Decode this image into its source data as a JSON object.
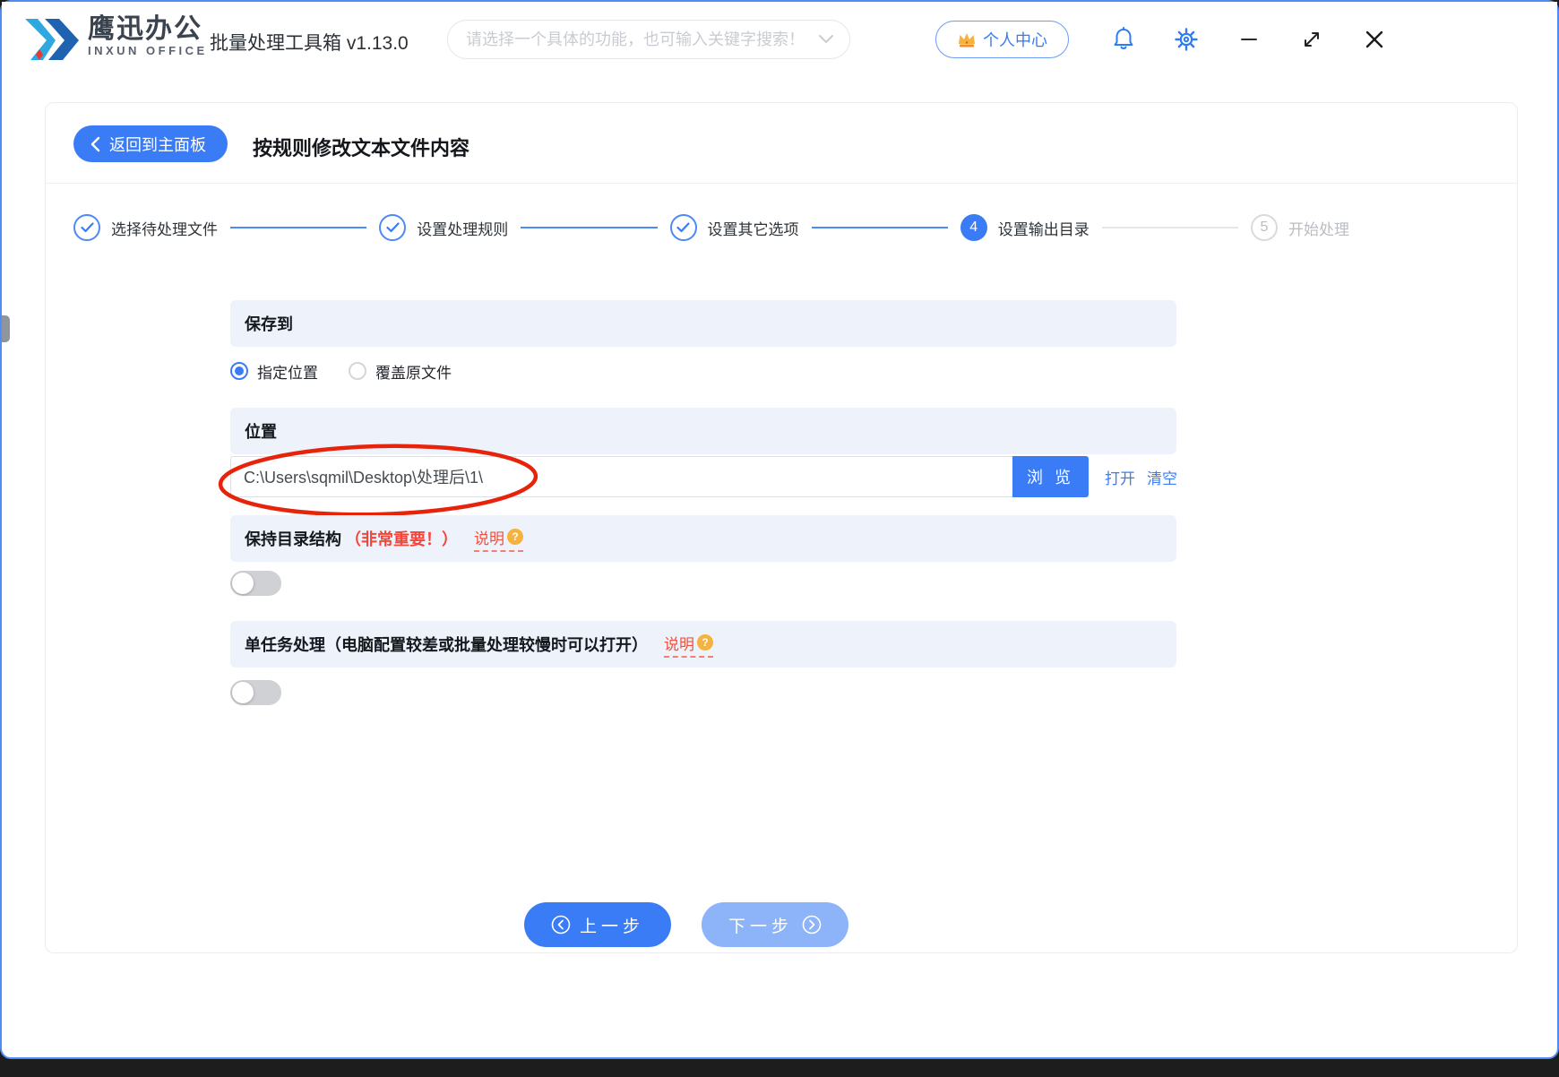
{
  "window": {
    "brand": {
      "name_cn": "鹰迅办公",
      "name_en": "INXUN OFFICE"
    },
    "app_title": "批量处理工具箱 v1.13.0",
    "search_placeholder": "请选择一个具体的功能，也可输入关键字搜索！",
    "user_center_label": "个人中心"
  },
  "page": {
    "back_label": "返回到主面板",
    "title": "按规则修改文本文件内容"
  },
  "stepper": {
    "steps": [
      {
        "label": "选择待处理文件",
        "state": "done"
      },
      {
        "label": "设置处理规则",
        "state": "done"
      },
      {
        "label": "设置其它选项",
        "state": "done"
      },
      {
        "label": "设置输出目录",
        "state": "active",
        "number": "4"
      },
      {
        "label": "开始处理",
        "state": "todo",
        "number": "5"
      }
    ]
  },
  "form": {
    "save_to": {
      "header": "保存到",
      "option_specified": "指定位置",
      "option_overwrite": "覆盖原文件"
    },
    "location": {
      "header": "位置",
      "path_value": "C:\\Users\\sqmil\\Desktop\\处理后\\1\\",
      "browse_label": "浏 览",
      "open_label": "打开",
      "clear_label": "清空"
    },
    "keep_structure": {
      "title": "保持目录结构",
      "warning": "（非常重要！）",
      "help_label": "说明",
      "help_badge": "?",
      "enabled": false
    },
    "single_task": {
      "title": "单任务处理（电脑配置较差或批量处理较慢时可以打开）",
      "help_label": "说明",
      "help_badge": "?",
      "enabled": false
    }
  },
  "footer": {
    "prev_label": "上一步",
    "next_label": "下一步"
  },
  "colors": {
    "accent_blue": "#3a7cf6",
    "next_button_blue": "#8db3f9",
    "section_bar_bg": "#eef3fb",
    "warning_red": "#f5453b",
    "annotation_red": "#e8230b",
    "badge_orange": "#f6b23e"
  }
}
